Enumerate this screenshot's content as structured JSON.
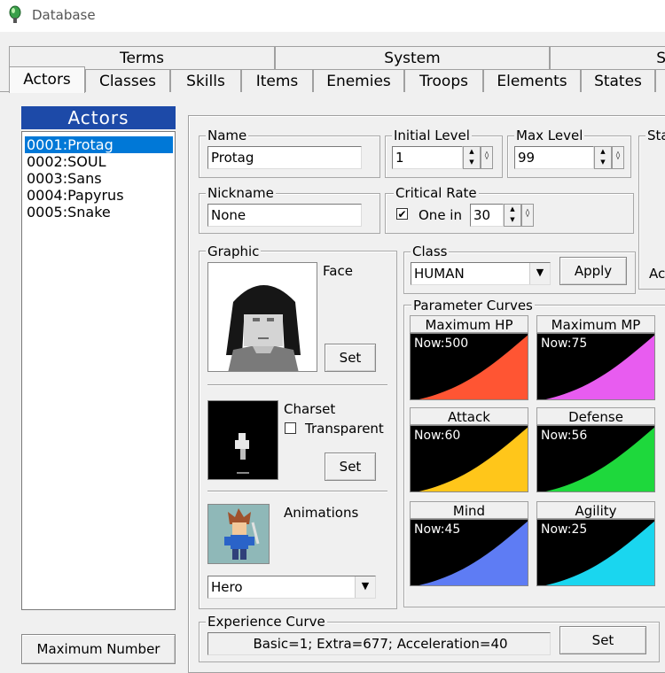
{
  "window": {
    "title": "Database"
  },
  "tabs_back": [
    "Terms",
    "System",
    "S"
  ],
  "tabs_front": [
    "Actors",
    "Classes",
    "Skills",
    "Items",
    "Enemies",
    "Troops",
    "Elements",
    "States"
  ],
  "actor_panel": {
    "header": "Actors",
    "items": [
      "0001:Protag",
      "0002:SOUL",
      "0003:Sans",
      "0004:Papyrus",
      "0005:Snake"
    ],
    "max_button": "Maximum Number"
  },
  "name": {
    "label": "Name",
    "value": "Protag"
  },
  "initial_level": {
    "label": "Initial Level",
    "value": "1"
  },
  "max_level": {
    "label": "Max Level",
    "value": "99"
  },
  "nickname": {
    "label": "Nickname",
    "value": "None"
  },
  "critical_rate": {
    "label": "Critical Rate",
    "check_label": "One in",
    "checked": "✔",
    "value": "30"
  },
  "graphic": {
    "label": "Graphic",
    "face_label": "Face",
    "set_label": "Set",
    "charset_label": "Charset",
    "transparent_label": "Transparent",
    "animations_label": "Animations",
    "animation_value": "Hero"
  },
  "class_box": {
    "label": "Class",
    "value": "HUMAN",
    "apply_label": "Apply"
  },
  "param_curves": {
    "label": "Parameter Curves",
    "curves": [
      {
        "title": "Maximum HP",
        "now": "Now:500",
        "color": "#ff5533"
      },
      {
        "title": "Maximum MP",
        "now": "Now:75",
        "color": "#e85cf0"
      },
      {
        "title": "Attack",
        "now": "Now:60",
        "color": "#ffc61a"
      },
      {
        "title": "Defense",
        "now": "Now:56",
        "color": "#1ed83c"
      },
      {
        "title": "Mind",
        "now": "Now:45",
        "color": "#5e7cf4"
      },
      {
        "title": "Agility",
        "now": "Now:25",
        "color": "#1ad6ef"
      }
    ]
  },
  "experience": {
    "label": "Experience Curve",
    "value": "Basic=1; Extra=677; Acceleration=40",
    "set_label": "Set"
  },
  "right_cut": {
    "label": "Sta",
    "extra": "Ac"
  },
  "colors": {
    "accent": "#0078d7",
    "header_blue": "#1d4aa8"
  }
}
